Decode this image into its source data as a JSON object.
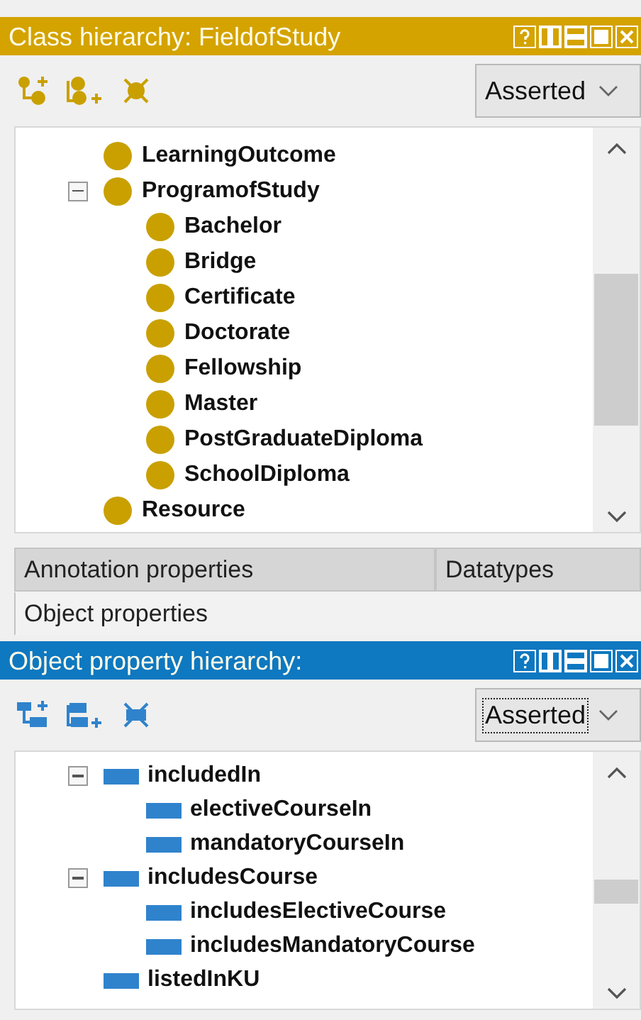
{
  "class_panel": {
    "kind": "class",
    "title": "Class hierarchy: FieldofStudy",
    "dropdown": {
      "value": "Asserted",
      "focused": false
    },
    "tree": [
      {
        "label": "LearningOutcome"
      },
      {
        "label": "ProgramofStudy",
        "expanded": true,
        "children": [
          {
            "label": "Bachelor"
          },
          {
            "label": "Bridge"
          },
          {
            "label": "Certificate"
          },
          {
            "label": "Doctorate"
          },
          {
            "label": "Fellowship"
          },
          {
            "label": "Master"
          },
          {
            "label": "PostGraduateDiploma"
          },
          {
            "label": "SchoolDiploma"
          }
        ]
      },
      {
        "label": "Resource"
      }
    ]
  },
  "tabs": [
    {
      "label": "Annotation properties",
      "selected": false
    },
    {
      "label": "Datatypes",
      "selected": false
    },
    {
      "label": "Object properties",
      "selected": true
    }
  ],
  "property_panel": {
    "kind": "property",
    "title": "Object property hierarchy:",
    "dropdown": {
      "value": "Asserted",
      "focused": true
    },
    "tree": [
      {
        "label": "includedIn",
        "expanded": true,
        "children": [
          {
            "label": "electiveCourseIn"
          },
          {
            "label": "mandatoryCourseIn"
          }
        ]
      },
      {
        "label": "includesCourse",
        "expanded": true,
        "children": [
          {
            "label": "includesElectiveCourse"
          },
          {
            "label": "includesMandatoryCourse"
          }
        ]
      },
      {
        "label": "listedInKU"
      }
    ]
  }
}
